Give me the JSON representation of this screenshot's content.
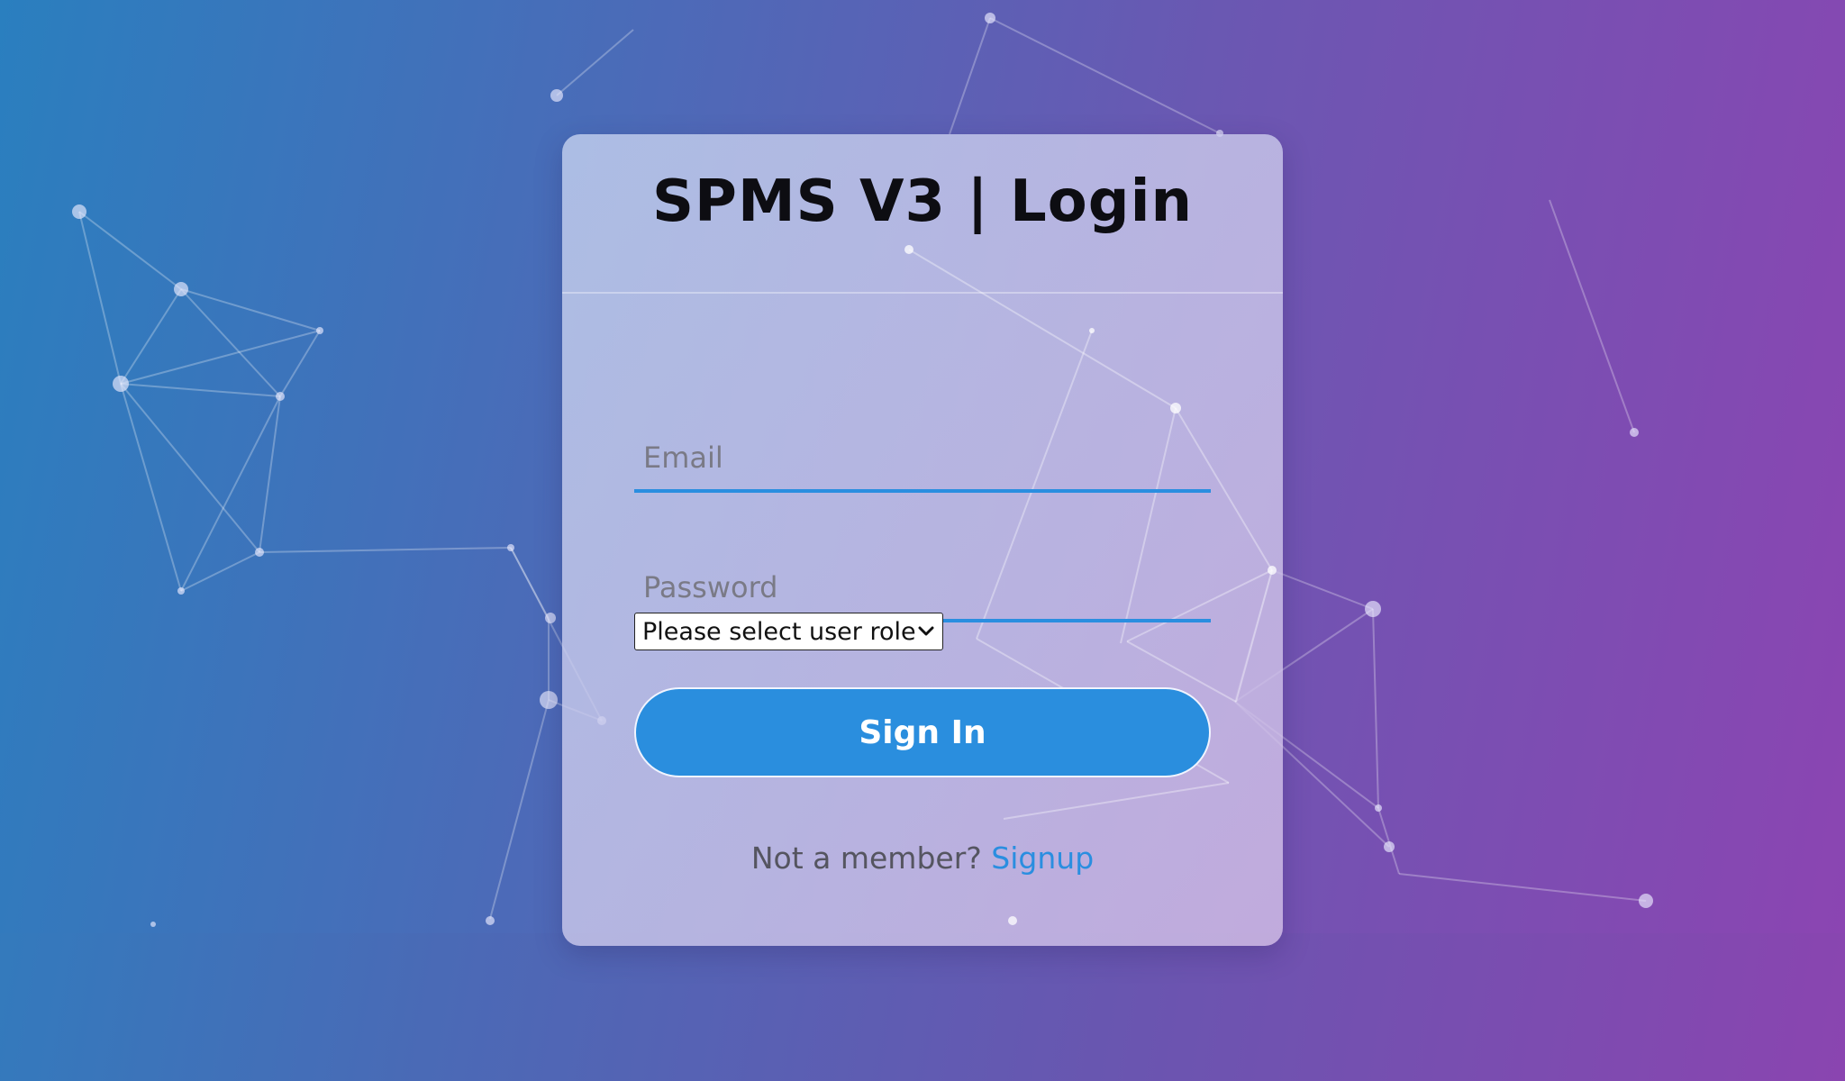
{
  "login": {
    "title": "SPMS V3 | Login",
    "email_placeholder": "Email",
    "password_placeholder": "Password",
    "role_select_value": "Please select user role",
    "signin_label": "Sign In",
    "signup_prompt": "Not a member?",
    "signup_link": "Signup"
  },
  "colors": {
    "accent": "#2a8ee0",
    "button": "#2a8ede",
    "background_start": "#2a7fbf",
    "background_end": "#8b45b2"
  },
  "icons": {
    "select_arrow": "chevron-down-icon"
  }
}
